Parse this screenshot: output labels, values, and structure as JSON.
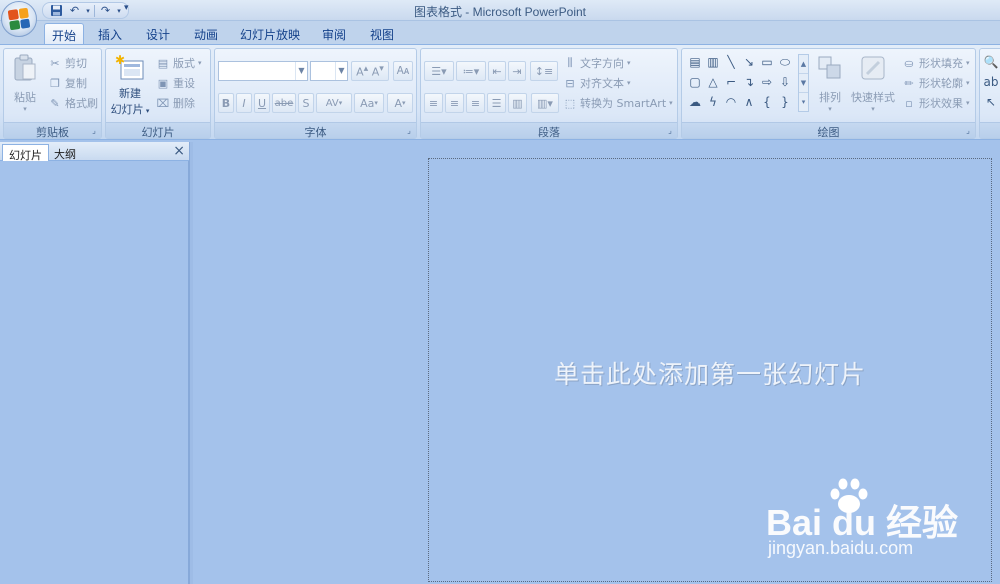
{
  "window": {
    "title": "图表格式 - Microsoft PowerPoint"
  },
  "quick_access": {
    "icons": [
      "save-icon",
      "undo-icon",
      "redo-icon",
      "customize-icon"
    ]
  },
  "tabs": [
    {
      "label": "开始",
      "active": true
    },
    {
      "label": "插入"
    },
    {
      "label": "设计"
    },
    {
      "label": "动画"
    },
    {
      "label": "幻灯片放映"
    },
    {
      "label": "审阅"
    },
    {
      "label": "视图"
    }
  ],
  "ribbon": {
    "clipboard": {
      "label": "剪贴板",
      "paste": "粘贴",
      "cut": "剪切",
      "copy": "复制",
      "format_painter": "格式刷"
    },
    "slides": {
      "label": "幻灯片",
      "new_slide_line1": "新建",
      "new_slide_line2": "幻灯片",
      "layout": "版式",
      "reset": "重设",
      "delete": "删除"
    },
    "font": {
      "label": "字体",
      "font_name": "",
      "font_size": "",
      "buttons": [
        "B",
        "I",
        "U",
        "abe",
        "S",
        "AV",
        "Aa",
        "A"
      ]
    },
    "paragraph": {
      "label": "段落",
      "text_direction": "文字方向",
      "align_text": "对齐文本",
      "convert_smartart": "转换为 SmartArt"
    },
    "drawing": {
      "label": "绘图",
      "arrange": "排列",
      "quick_styles": "快速样式",
      "shape_fill": "形状填充",
      "shape_outline": "形状轮廓",
      "shape_effects": "形状效果"
    }
  },
  "left_pane": {
    "tab_slides": "幻灯片",
    "tab_outline": "大纲",
    "close": "×"
  },
  "slide": {
    "placeholder": "单击此处添加第一张幻灯片"
  },
  "watermark": {
    "logo": "Bai du 经验",
    "url": "jingyan.baidu.com"
  },
  "colors": {
    "background": "#a4c2eb",
    "ribbon": "#dbe7f7",
    "text": "#15428b"
  }
}
